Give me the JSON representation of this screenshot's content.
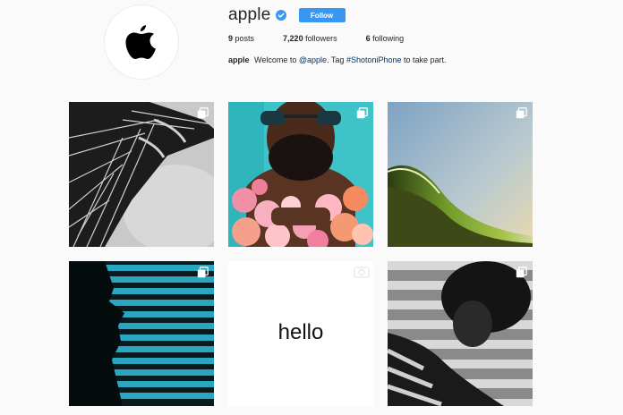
{
  "profile": {
    "username": "apple",
    "follow_label": "Follow",
    "stats": {
      "posts_count": "9",
      "posts_label": "posts",
      "followers_count": "7,220",
      "followers_label": "followers",
      "following_count": "6",
      "following_label": "following"
    },
    "bio": {
      "name": "apple",
      "text_1": "Welcome to",
      "mention": "@apple",
      "text_2": ". Tag",
      "hashtag": "#ShotoniPhone",
      "text_3": "to take part."
    }
  },
  "colors": {
    "accent": "#3897f0",
    "link": "#003569",
    "background": "#fafafa"
  },
  "posts": [
    {
      "subject": "eiffel-tower",
      "icon": "multiple-posts-icon"
    },
    {
      "subject": "man-with-flowers",
      "icon": "multiple-posts-icon"
    },
    {
      "subject": "ocean-wave",
      "icon": "multiple-posts-icon"
    },
    {
      "subject": "blinds-silhouette",
      "icon": "multiple-posts-icon"
    },
    {
      "subject": "hello",
      "text": "hello",
      "icon": "video-icon"
    },
    {
      "subject": "woman-portrait",
      "icon": "multiple-posts-icon"
    }
  ]
}
